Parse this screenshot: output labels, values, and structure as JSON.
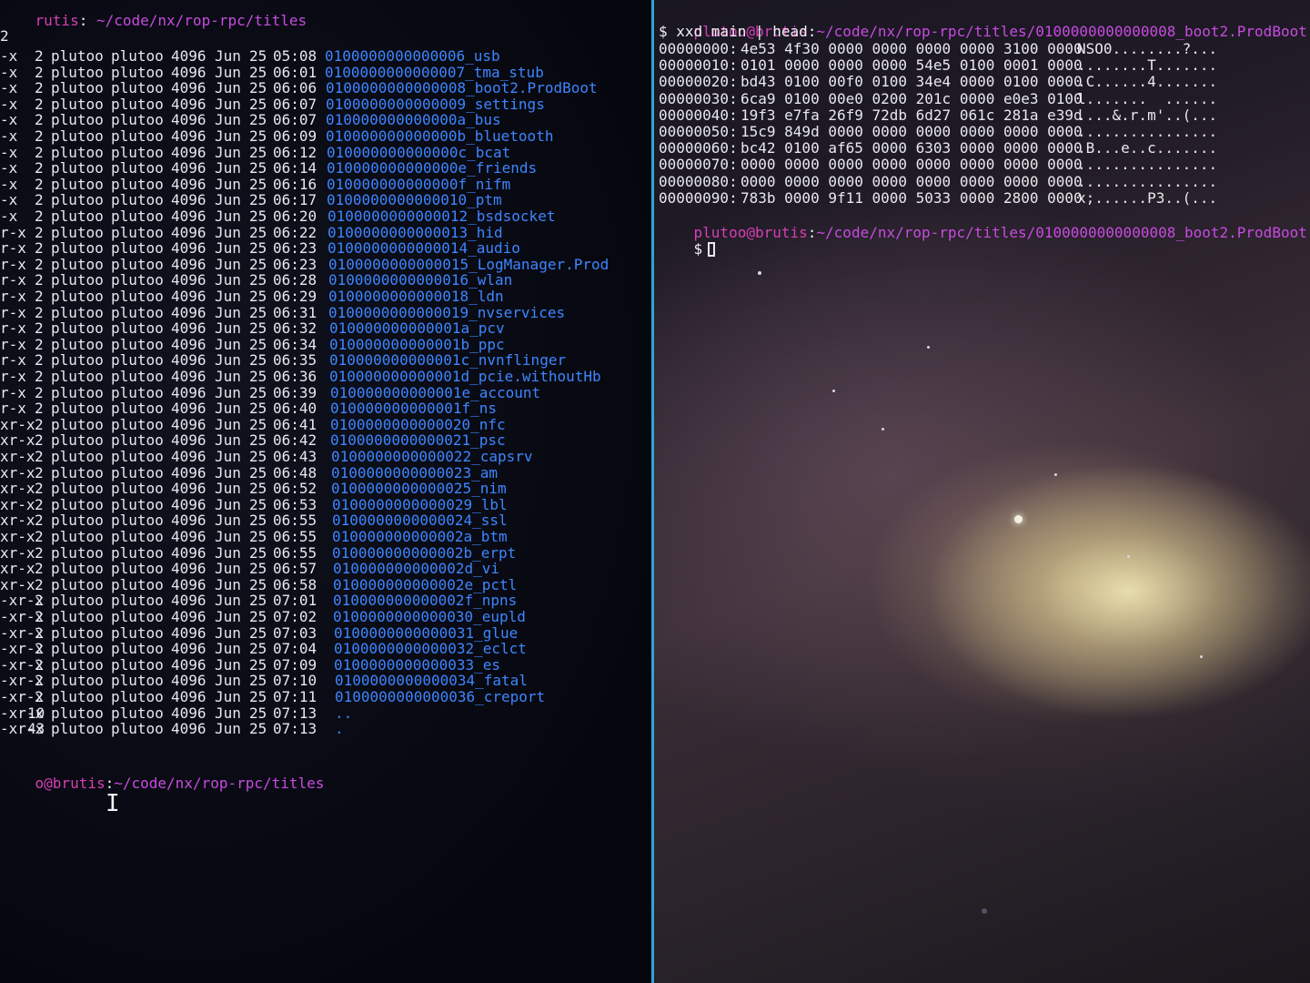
{
  "left": {
    "title_prompt_user": "rutis",
    "title_prompt_path": "~/code/nx/rop-rpc/titles",
    "total_line": "2",
    "entries": [
      {
        "perm": "-x",
        "links": "2",
        "owner": "plutoo",
        "group": "plutoo",
        "size": "4096",
        "month": "Jun",
        "day": "25",
        "time": "05:08",
        "name": "0100000000000006_usb"
      },
      {
        "perm": "-x",
        "links": "2",
        "owner": "plutoo",
        "group": "plutoo",
        "size": "4096",
        "month": "Jun",
        "day": "25",
        "time": "06:01",
        "name": "0100000000000007_tma_stub"
      },
      {
        "perm": "-x",
        "links": "2",
        "owner": "plutoo",
        "group": "plutoo",
        "size": "4096",
        "month": "Jun",
        "day": "25",
        "time": "06:06",
        "name": "0100000000000008_boot2.ProdBoot"
      },
      {
        "perm": "-x",
        "links": "2",
        "owner": "plutoo",
        "group": "plutoo",
        "size": "4096",
        "month": "Jun",
        "day": "25",
        "time": "06:07",
        "name": "0100000000000009_settings"
      },
      {
        "perm": "-x",
        "links": "2",
        "owner": "plutoo",
        "group": "plutoo",
        "size": "4096",
        "month": "Jun",
        "day": "25",
        "time": "06:07",
        "name": "010000000000000a_bus"
      },
      {
        "perm": "-x",
        "links": "2",
        "owner": "plutoo",
        "group": "plutoo",
        "size": "4096",
        "month": "Jun",
        "day": "25",
        "time": "06:09",
        "name": "010000000000000b_bluetooth"
      },
      {
        "perm": "-x",
        "links": "2",
        "owner": "plutoo",
        "group": "plutoo",
        "size": "4096",
        "month": "Jun",
        "day": "25",
        "time": "06:12",
        "name": "010000000000000c_bcat"
      },
      {
        "perm": "-x",
        "links": "2",
        "owner": "plutoo",
        "group": "plutoo",
        "size": "4096",
        "month": "Jun",
        "day": "25",
        "time": "06:14",
        "name": "010000000000000e_friends"
      },
      {
        "perm": "-x",
        "links": "2",
        "owner": "plutoo",
        "group": "plutoo",
        "size": "4096",
        "month": "Jun",
        "day": "25",
        "time": "06:16",
        "name": "010000000000000f_nifm"
      },
      {
        "perm": "-x",
        "links": "2",
        "owner": "plutoo",
        "group": "plutoo",
        "size": "4096",
        "month": "Jun",
        "day": "25",
        "time": "06:17",
        "name": "0100000000000010_ptm"
      },
      {
        "perm": "-x",
        "links": "2",
        "owner": "plutoo",
        "group": "plutoo",
        "size": "4096",
        "month": "Jun",
        "day": "25",
        "time": "06:20",
        "name": "0100000000000012_bsdsocket"
      },
      {
        "perm": "r-x",
        "links": "2",
        "owner": "plutoo",
        "group": "plutoo",
        "size": "4096",
        "month": "Jun",
        "day": "25",
        "time": "06:22",
        "name": "0100000000000013_hid"
      },
      {
        "perm": "r-x",
        "links": "2",
        "owner": "plutoo",
        "group": "plutoo",
        "size": "4096",
        "month": "Jun",
        "day": "25",
        "time": "06:23",
        "name": "0100000000000014_audio"
      },
      {
        "perm": "r-x",
        "links": "2",
        "owner": "plutoo",
        "group": "plutoo",
        "size": "4096",
        "month": "Jun",
        "day": "25",
        "time": "06:23",
        "name": "0100000000000015_LogManager.Prod"
      },
      {
        "perm": "r-x",
        "links": "2",
        "owner": "plutoo",
        "group": "plutoo",
        "size": "4096",
        "month": "Jun",
        "day": "25",
        "time": "06:28",
        "name": "0100000000000016_wlan"
      },
      {
        "perm": "r-x",
        "links": "2",
        "owner": "plutoo",
        "group": "plutoo",
        "size": "4096",
        "month": "Jun",
        "day": "25",
        "time": "06:29",
        "name": "0100000000000018_ldn"
      },
      {
        "perm": "r-x",
        "links": "2",
        "owner": "plutoo",
        "group": "plutoo",
        "size": "4096",
        "month": "Jun",
        "day": "25",
        "time": "06:31",
        "name": "0100000000000019_nvservices"
      },
      {
        "perm": "r-x",
        "links": "2",
        "owner": "plutoo",
        "group": "plutoo",
        "size": "4096",
        "month": "Jun",
        "day": "25",
        "time": "06:32",
        "name": "010000000000001a_pcv"
      },
      {
        "perm": "r-x",
        "links": "2",
        "owner": "plutoo",
        "group": "plutoo",
        "size": "4096",
        "month": "Jun",
        "day": "25",
        "time": "06:34",
        "name": "010000000000001b_ppc"
      },
      {
        "perm": "r-x",
        "links": "2",
        "owner": "plutoo",
        "group": "plutoo",
        "size": "4096",
        "month": "Jun",
        "day": "25",
        "time": "06:35",
        "name": "010000000000001c_nvnflinger"
      },
      {
        "perm": "r-x",
        "links": "2",
        "owner": "plutoo",
        "group": "plutoo",
        "size": "4096",
        "month": "Jun",
        "day": "25",
        "time": "06:36",
        "name": "010000000000001d_pcie.withoutHb"
      },
      {
        "perm": "r-x",
        "links": "2",
        "owner": "plutoo",
        "group": "plutoo",
        "size": "4096",
        "month": "Jun",
        "day": "25",
        "time": "06:39",
        "name": "010000000000001e_account"
      },
      {
        "perm": "r-x",
        "links": "2",
        "owner": "plutoo",
        "group": "plutoo",
        "size": "4096",
        "month": "Jun",
        "day": "25",
        "time": "06:40",
        "name": "010000000000001f_ns"
      },
      {
        "perm": "xr-x",
        "links": "2",
        "owner": "plutoo",
        "group": "plutoo",
        "size": "4096",
        "month": "Jun",
        "day": "25",
        "time": "06:41",
        "name": "0100000000000020_nfc"
      },
      {
        "perm": "xr-x",
        "links": "2",
        "owner": "plutoo",
        "group": "plutoo",
        "size": "4096",
        "month": "Jun",
        "day": "25",
        "time": "06:42",
        "name": "0100000000000021_psc"
      },
      {
        "perm": "xr-x",
        "links": "2",
        "owner": "plutoo",
        "group": "plutoo",
        "size": "4096",
        "month": "Jun",
        "day": "25",
        "time": "06:43",
        "name": "0100000000000022_capsrv"
      },
      {
        "perm": "xr-x",
        "links": "2",
        "owner": "plutoo",
        "group": "plutoo",
        "size": "4096",
        "month": "Jun",
        "day": "25",
        "time": "06:48",
        "name": "0100000000000023_am"
      },
      {
        "perm": "xr-x",
        "links": "2",
        "owner": "plutoo",
        "group": "plutoo",
        "size": "4096",
        "month": "Jun",
        "day": "25",
        "time": "06:52",
        "name": "0100000000000025_nim"
      },
      {
        "perm": "xr-x",
        "links": "2",
        "owner": "plutoo",
        "group": "plutoo",
        "size": "4096",
        "month": "Jun",
        "day": "25",
        "time": "06:53",
        "name": "0100000000000029_lbl"
      },
      {
        "perm": "xr-x",
        "links": "2",
        "owner": "plutoo",
        "group": "plutoo",
        "size": "4096",
        "month": "Jun",
        "day": "25",
        "time": "06:55",
        "name": "0100000000000024_ssl"
      },
      {
        "perm": "xr-x",
        "links": "2",
        "owner": "plutoo",
        "group": "plutoo",
        "size": "4096",
        "month": "Jun",
        "day": "25",
        "time": "06:55",
        "name": "010000000000002a_btm"
      },
      {
        "perm": "xr-x",
        "links": "2",
        "owner": "plutoo",
        "group": "plutoo",
        "size": "4096",
        "month": "Jun",
        "day": "25",
        "time": "06:55",
        "name": "010000000000002b_erpt"
      },
      {
        "perm": "xr-x",
        "links": "2",
        "owner": "plutoo",
        "group": "plutoo",
        "size": "4096",
        "month": "Jun",
        "day": "25",
        "time": "06:57",
        "name": "010000000000002d_vi"
      },
      {
        "perm": "xr-x",
        "links": "2",
        "owner": "plutoo",
        "group": "plutoo",
        "size": "4096",
        "month": "Jun",
        "day": "25",
        "time": "06:58",
        "name": "010000000000002e_pctl"
      },
      {
        "perm": "-xr-x",
        "links": "2",
        "owner": "plutoo",
        "group": "plutoo",
        "size": "4096",
        "month": "Jun",
        "day": "25",
        "time": "07:01",
        "name": "010000000000002f_npns"
      },
      {
        "perm": "-xr-x",
        "links": "2",
        "owner": "plutoo",
        "group": "plutoo",
        "size": "4096",
        "month": "Jun",
        "day": "25",
        "time": "07:02",
        "name": "0100000000000030_eupld"
      },
      {
        "perm": "-xr-x",
        "links": "2",
        "owner": "plutoo",
        "group": "plutoo",
        "size": "4096",
        "month": "Jun",
        "day": "25",
        "time": "07:03",
        "name": "0100000000000031_glue"
      },
      {
        "perm": "-xr-x",
        "links": "2",
        "owner": "plutoo",
        "group": "plutoo",
        "size": "4096",
        "month": "Jun",
        "day": "25",
        "time": "07:04",
        "name": "0100000000000032_eclct"
      },
      {
        "perm": "-xr-x",
        "links": "2",
        "owner": "plutoo",
        "group": "plutoo",
        "size": "4096",
        "month": "Jun",
        "day": "25",
        "time": "07:09",
        "name": "0100000000000033_es"
      },
      {
        "perm": "-xr-x",
        "links": "2",
        "owner": "plutoo",
        "group": "plutoo",
        "size": "4096",
        "month": "Jun",
        "day": "25",
        "time": "07:10",
        "name": "0100000000000034_fatal"
      },
      {
        "perm": "-xr-x",
        "links": "2",
        "owner": "plutoo",
        "group": "plutoo",
        "size": "4096",
        "month": "Jun",
        "day": "25",
        "time": "07:11",
        "name": "0100000000000036_creport"
      },
      {
        "perm": "-xr-x",
        "links": "10",
        "owner": "plutoo",
        "group": "plutoo",
        "size": "4096",
        "month": "Jun",
        "day": "25",
        "time": "07:13",
        "name": ".."
      },
      {
        "perm": "-xr-x",
        "links": "43",
        "owner": "plutoo",
        "group": "plutoo",
        "size": "4096",
        "month": "Jun",
        "day": "25",
        "time": "07:13",
        "name": "."
      }
    ],
    "bottom_prompt_user": "o@brutis",
    "bottom_prompt_path": "~/code/nx/rop-rpc/titles"
  },
  "right": {
    "prompt_user": "plutoo@brutis",
    "prompt_path": "~/code/nx/rop-rpc/titles/0100000000000008_boot2.ProdBoot",
    "command": "$ xxd main | head",
    "hex_rows": [
      {
        "offset": "00000000:",
        "words": "4e53 4f30 0000 0000 0000 0000 3100 0000",
        "ascii": "NSO0........?..."
      },
      {
        "offset": "00000010:",
        "words": "0101 0000 0000 0000 54e5 0100 0001 0000",
        "ascii": "........T......."
      },
      {
        "offset": "00000020:",
        "words": "bd43 0100 00f0 0100 34e4 0000 0100 0000",
        "ascii": ".C......4......."
      },
      {
        "offset": "00000030:",
        "words": "6ca9 0100 00e0 0200 201c 0000 e0e3 0100",
        "ascii": "l.......  ......"
      },
      {
        "offset": "00000040:",
        "words": "19f3 e7fa 26f9 72db 6d27 061c 281a e39d",
        "ascii": "....&.r.m'..(..."
      },
      {
        "offset": "00000050:",
        "words": "15c9 849d 0000 0000 0000 0000 0000 0000",
        "ascii": "................"
      },
      {
        "offset": "00000060:",
        "words": "bc42 0100 af65 0000 6303 0000 0000 0000",
        "ascii": ".B...e..c......."
      },
      {
        "offset": "00000070:",
        "words": "0000 0000 0000 0000 0000 0000 0000 0000",
        "ascii": "................"
      },
      {
        "offset": "00000080:",
        "words": "0000 0000 0000 0000 0000 0000 0000 0000",
        "ascii": "................"
      },
      {
        "offset": "00000090:",
        "words": "783b 0000 9f11 0000 5033 0000 2800 0000",
        "ascii": "x;......P3..(..."
      }
    ],
    "prompt2_user": "plutoo@brutis",
    "prompt2_path": "~/code/nx/rop-rpc/titles/0100000000000008_boot2.ProdBoot",
    "current_input": "$"
  },
  "colors": {
    "accent_divider": "#2fa4d6",
    "dir_name": "#3d86ff",
    "prompt_user": "#d63fb5",
    "prompt_path": "#c84be0"
  }
}
